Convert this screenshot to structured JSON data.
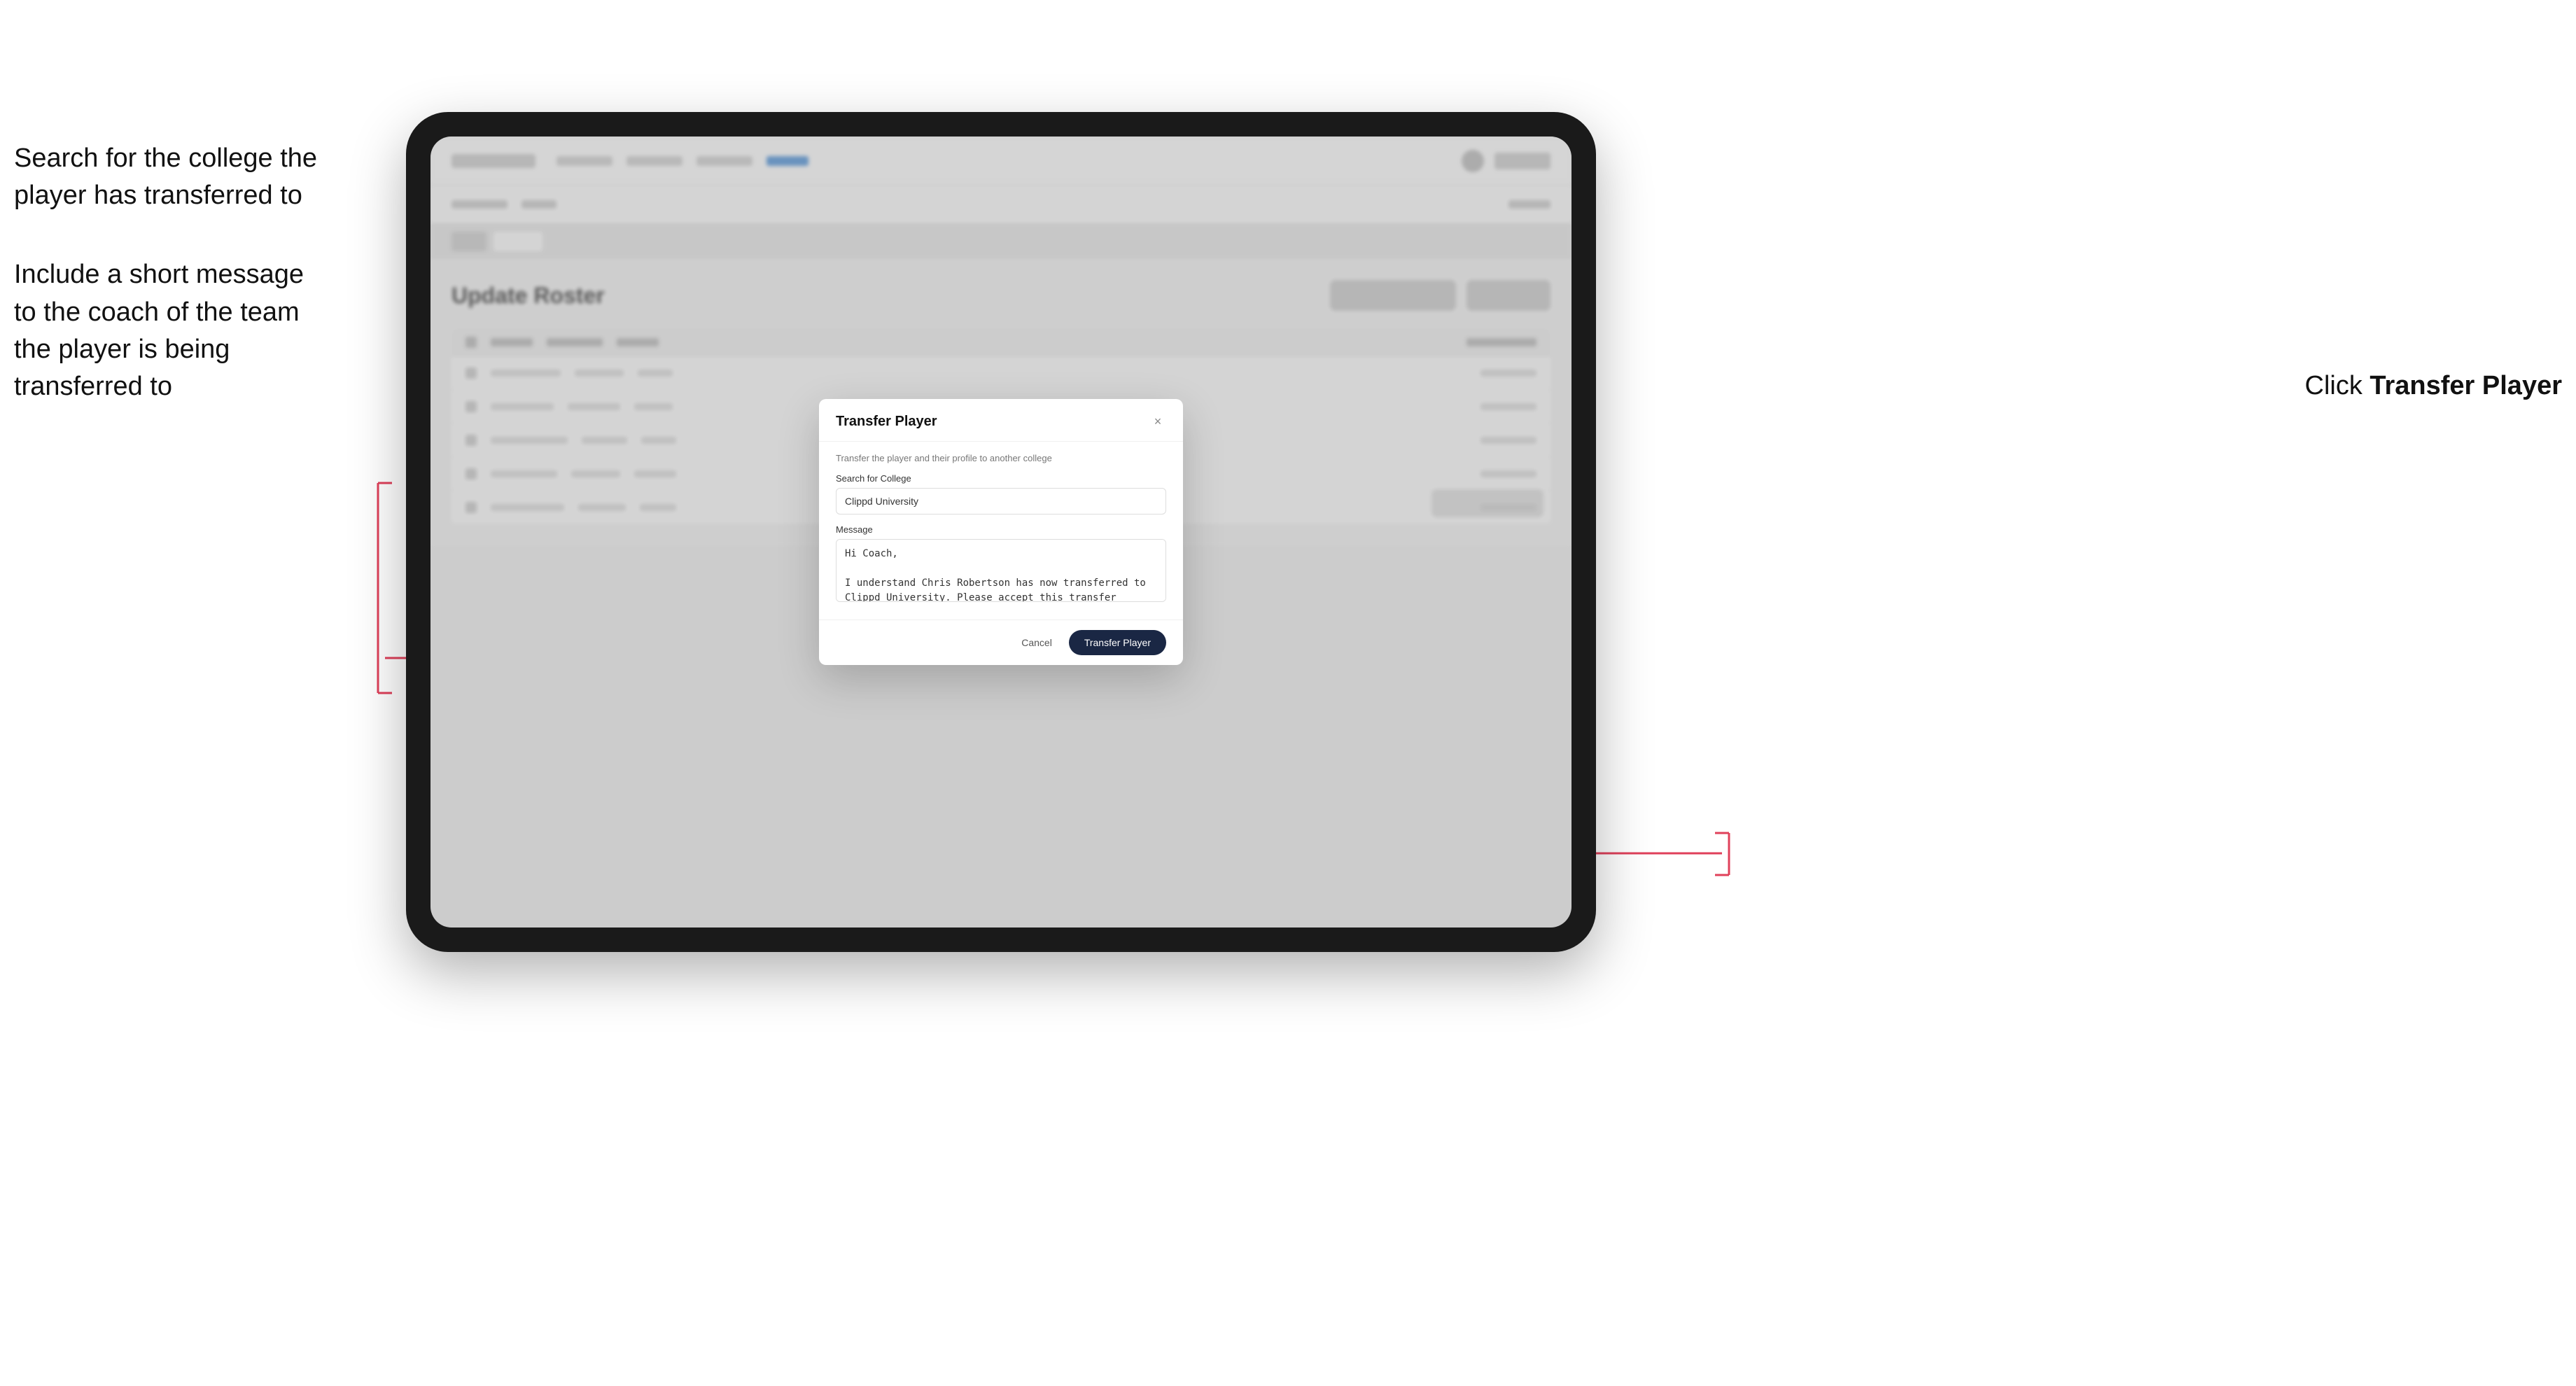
{
  "annotations": {
    "left_top": "Search for the college the player has transferred to",
    "left_bottom": "Include a short message\nto the coach of the team\nthe player is being\ntransferred to",
    "right": "Click Transfer Player"
  },
  "modal": {
    "title": "Transfer Player",
    "subtitle": "Transfer the player and their profile to another college",
    "search_label": "Search for College",
    "search_value": "Clippd University",
    "message_label": "Message",
    "message_value": "Hi Coach,\n\nI understand Chris Robertson has now transferred to Clippd University. Please accept this transfer request when you can.",
    "cancel_label": "Cancel",
    "transfer_label": "Transfer Player",
    "close_icon": "×"
  },
  "page": {
    "title": "Update Roster"
  }
}
